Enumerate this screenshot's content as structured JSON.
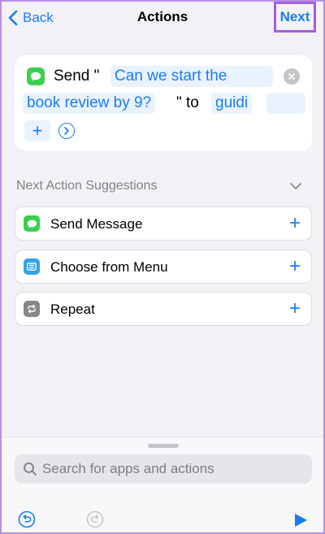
{
  "nav": {
    "back_label": "Back",
    "title": "Actions",
    "next_label": "Next"
  },
  "action": {
    "send_label": "Send \"",
    "message_text_line1": "Can we start the",
    "message_text_line2": "book review by 9?",
    "to_label": "\" to",
    "recipient": "guidi",
    "add_symbol": "+"
  },
  "suggestions": {
    "title": "Next Action Suggestions",
    "items": [
      {
        "label": "Send Message",
        "icon": "messages-icon",
        "color": "#3bcf4e"
      },
      {
        "label": "Choose from Menu",
        "icon": "menu-icon",
        "color": "#36a2e6"
      },
      {
        "label": "Repeat",
        "icon": "repeat-icon",
        "color": "#86868b"
      }
    ],
    "add_symbol": "+"
  },
  "bottom": {
    "search_placeholder": "Search for apps and actions"
  },
  "colors": {
    "accent": "#1a7cf4",
    "highlight": "#a25fe0"
  }
}
